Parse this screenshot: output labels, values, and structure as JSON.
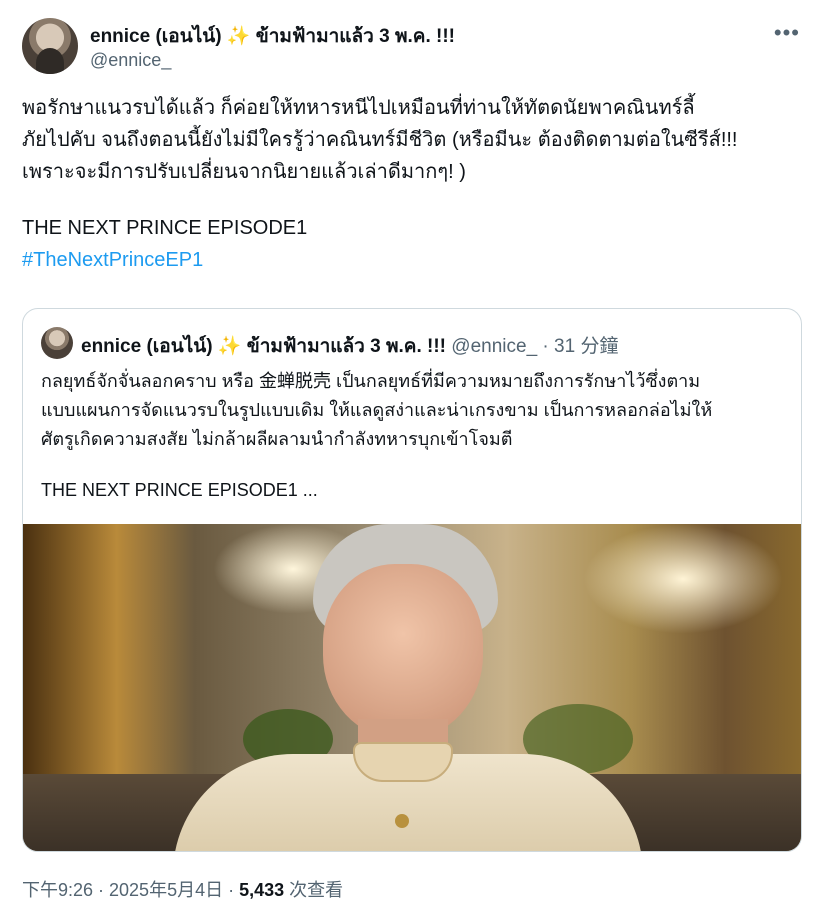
{
  "author": {
    "name": "ennice (เอนไน์) ✨ ข้ามฟ้ามาแล้ว 3 พ.ค. !!!",
    "handle": "@ennice_"
  },
  "tweet": {
    "lines": [
      "พอรักษาแนวรบได้แล้ว ก็ค่อยให้ทหารหนีไปเหมือนที่ท่านให้ทัตดนัยพาคณินทร์ลี้",
      "ภัยไปคับ จนถึงตอนนี้ยังไม่มีใครรู้ว่าคณินทร์มีชีวิต (หรือมีนะ ต้องติดตามต่อในซีรีส์!!!",
      "เพราะจะมีการปรับเปลี่ยนจากนิยายแล้วเล่าดีมากๆ! )"
    ],
    "episode_line": "THE NEXT PRINCE EPISODE1",
    "hashtag": "#TheNextPrinceEP1"
  },
  "quoted": {
    "name": "ennice (เอนไน์) ✨ ข้ามฟ้ามาแล้ว 3 พ.ค. !!!",
    "handle": "@ennice_",
    "separator": "·",
    "time": "31 分鐘",
    "lines": [
      "กลยุทธ์จักจั่นลอกคราบ หรือ 金蝉脱壳 เป็นกลยุทธ์ที่มีความหมายถึงการรักษาไว้ซึ่งตาม",
      "แบบแผนการจัดแนวรบในรูปแบบเดิม ให้แลดูสง่าและน่าเกรงขาม เป็นการหลอกล่อไม่ให้",
      "ศัตรูเกิดความสงสัย ไม่กล้าผลีผลามนำกำลังทหารบุกเข้าโจมตี"
    ],
    "episode_line": "THE NEXT PRINCE EPISODE1  ..."
  },
  "meta": {
    "timestamp": "下午9:26 · 2025年5月4日 · ",
    "views_count": "5,433",
    "views_label": " 次查看"
  },
  "icons": {
    "more": "more-horizontal-icon",
    "sparkle": "sparkles-icon"
  },
  "colors": {
    "link": "#1d9bf0",
    "secondary_text": "#536471",
    "border": "#cfd9de"
  }
}
